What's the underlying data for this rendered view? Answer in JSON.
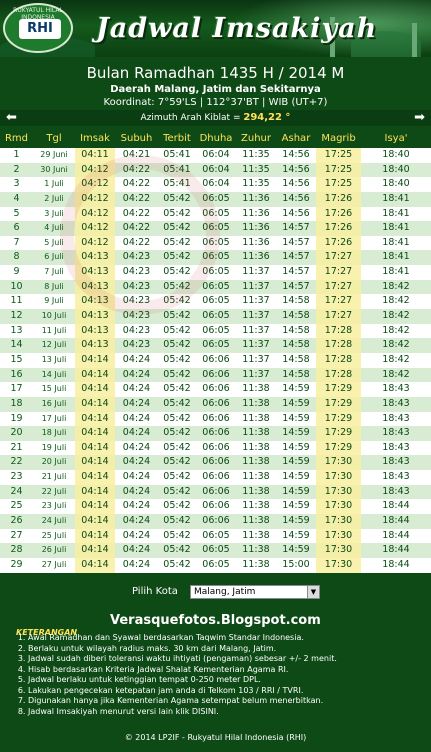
{
  "banner": {
    "title": "Jadwal Imsakiyah",
    "logo_text": "RHI",
    "logo_ring_text": "RUKYATUL HILAL INDONESIA"
  },
  "info": {
    "month": "Bulan Ramadhan 1435 H / 2014 M",
    "region": "Daerah Malang, Jatim dan Sekitarnya",
    "coord": "Koordinat: 7°59'LS | 112°37'BT | WIB (UT+7)"
  },
  "kiblat": {
    "label": "Azimuth Arah Kiblat = ",
    "value": "294,22 °",
    "left_arrow": "⬅",
    "right_arrow": "➡"
  },
  "table": {
    "headers": [
      "Rmd",
      "Tgl",
      "Imsak",
      "Subuh",
      "Terbit",
      "Dhuha",
      "Zuhur",
      "Ashar",
      "Magrib",
      "Isya'"
    ],
    "rows": [
      [
        "1",
        "29 Juni",
        "04:11",
        "04:21",
        "05:41",
        "06:04",
        "11:35",
        "14:56",
        "17:25",
        "18:40"
      ],
      [
        "2",
        "30 Juni",
        "04:12",
        "04:22",
        "05:41",
        "06:04",
        "11:35",
        "14:56",
        "17:25",
        "18:40"
      ],
      [
        "3",
        "1 Juli",
        "04:12",
        "04:22",
        "05:41",
        "06:04",
        "11:35",
        "14:56",
        "17:25",
        "18:40"
      ],
      [
        "4",
        "2 Juli",
        "04:12",
        "04:22",
        "05:42",
        "06:05",
        "11:36",
        "14:56",
        "17:26",
        "18:41"
      ],
      [
        "5",
        "3 Juli",
        "04:12",
        "04:22",
        "05:42",
        "06:05",
        "11:36",
        "14:56",
        "17:26",
        "18:41"
      ],
      [
        "6",
        "4 Juli",
        "04:12",
        "04:22",
        "05:42",
        "06:05",
        "11:36",
        "14:57",
        "17:26",
        "18:41"
      ],
      [
        "7",
        "5 Juli",
        "04:12",
        "04:22",
        "05:42",
        "06:05",
        "11:36",
        "14:57",
        "17:26",
        "18:41"
      ],
      [
        "8",
        "6 Juli",
        "04:13",
        "04:23",
        "05:42",
        "06:05",
        "11:36",
        "14:57",
        "17:27",
        "18:41"
      ],
      [
        "9",
        "7 Juli",
        "04:13",
        "04:23",
        "05:42",
        "06:05",
        "11:37",
        "14:57",
        "17:27",
        "18:41"
      ],
      [
        "10",
        "8 Juli",
        "04:13",
        "04:23",
        "05:42",
        "06:05",
        "11:37",
        "14:57",
        "17:27",
        "18:42"
      ],
      [
        "11",
        "9 Juli",
        "04:13",
        "04:23",
        "05:42",
        "06:05",
        "11:37",
        "14:58",
        "17:27",
        "18:42"
      ],
      [
        "12",
        "10 Juli",
        "04:13",
        "04:23",
        "05:42",
        "06:05",
        "11:37",
        "14:58",
        "17:27",
        "18:42"
      ],
      [
        "13",
        "11 Juli",
        "04:13",
        "04:23",
        "05:42",
        "06:05",
        "11:37",
        "14:58",
        "17:28",
        "18:42"
      ],
      [
        "14",
        "12 Juli",
        "04:13",
        "04:23",
        "05:42",
        "06:05",
        "11:37",
        "14:58",
        "17:28",
        "18:42"
      ],
      [
        "15",
        "13 Juli",
        "04:14",
        "04:24",
        "05:42",
        "06:06",
        "11:37",
        "14:58",
        "17:28",
        "18:42"
      ],
      [
        "16",
        "14 Juli",
        "04:14",
        "04:24",
        "05:42",
        "06:06",
        "11:37",
        "14:58",
        "17:28",
        "18:42"
      ],
      [
        "17",
        "15 Juli",
        "04:14",
        "04:24",
        "05:42",
        "06:06",
        "11:38",
        "14:59",
        "17:29",
        "18:43"
      ],
      [
        "18",
        "16 Juli",
        "04:14",
        "04:24",
        "05:42",
        "06:06",
        "11:38",
        "14:59",
        "17:29",
        "18:43"
      ],
      [
        "19",
        "17 Juli",
        "04:14",
        "04:24",
        "05:42",
        "06:06",
        "11:38",
        "14:59",
        "17:29",
        "18:43"
      ],
      [
        "20",
        "18 Juli",
        "04:14",
        "04:24",
        "05:42",
        "06:06",
        "11:38",
        "14:59",
        "17:29",
        "18:43"
      ],
      [
        "21",
        "19 Juli",
        "04:14",
        "04:24",
        "05:42",
        "06:06",
        "11:38",
        "14:59",
        "17:29",
        "18:43"
      ],
      [
        "22",
        "20 Juli",
        "04:14",
        "04:24",
        "05:42",
        "06:06",
        "11:38",
        "14:59",
        "17:30",
        "18:43"
      ],
      [
        "23",
        "21 Juli",
        "04:14",
        "04:24",
        "05:42",
        "06:06",
        "11:38",
        "14:59",
        "17:30",
        "18:43"
      ],
      [
        "24",
        "22 Juli",
        "04:14",
        "04:24",
        "05:42",
        "06:06",
        "11:38",
        "14:59",
        "17:30",
        "18:43"
      ],
      [
        "25",
        "23 Juli",
        "04:14",
        "04:24",
        "05:42",
        "06:06",
        "11:38",
        "14:59",
        "17:30",
        "18:44"
      ],
      [
        "26",
        "24 Juli",
        "04:14",
        "04:24",
        "05:42",
        "06:06",
        "11:38",
        "14:59",
        "17:30",
        "18:44"
      ],
      [
        "27",
        "25 Juli",
        "04:14",
        "04:24",
        "05:42",
        "06:05",
        "11:38",
        "14:59",
        "17:30",
        "18:44"
      ],
      [
        "28",
        "26 Juli",
        "04:14",
        "04:24",
        "05:42",
        "06:05",
        "11:38",
        "14:59",
        "17:30",
        "18:44"
      ],
      [
        "29",
        "27 Juli",
        "04:14",
        "04:24",
        "05:42",
        "06:05",
        "11:38",
        "15:00",
        "17:30",
        "18:44"
      ]
    ]
  },
  "city": {
    "label": "Pilih Kota",
    "selected": "Malang, Jatim"
  },
  "notes": {
    "heading": "KETERANGAN",
    "blog": "Verasquefotos.Blogspot.com",
    "items": [
      "Awal Ramadhan dan Syawal berdasarkan Taqwim Standar Indonesia.",
      "Berlaku untuk wilayah radius maks. 30 km dari Malang, Jatim.",
      "Jadwal sudah diberi toleransi waktu ihtiyati (pengaman) sebesar +/- 2 menit.",
      "Hisab berdasarkan Kriteria Jadwal Shalat Kementerian Agama RI.",
      "Jadwal berlaku untuk ketinggian tempat 0-250 meter DPL.",
      "Lakukan pengecekan ketepatan jam anda di Telkom 103 / RRI / TVRI.",
      "Digunakan hanya jika Kementerian Agama setempat belum menerbitkan.",
      "Jadwal Imsakiyah menurut versi lain klik DISINI."
    ]
  },
  "footer": {
    "text": "© 2014 LP2IF - Rukyatul Hilal Indonesia (RHI)"
  },
  "colors": {
    "background": "#0e4a16",
    "header_text": "#ffe25a",
    "row_odd": "#ffffff",
    "row_even": "#d8ecd4",
    "highlight_column": "#f8eea0"
  }
}
